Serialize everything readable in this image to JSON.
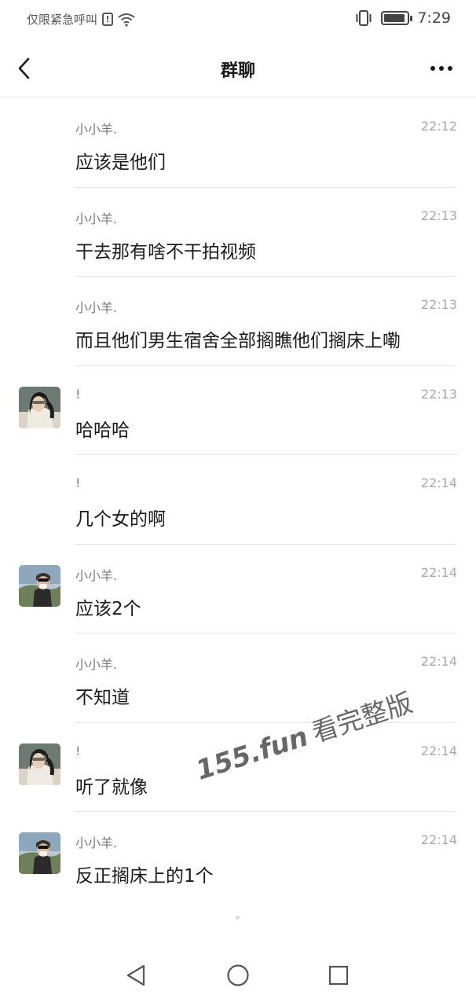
{
  "status_bar": {
    "carrier": "仅限紧急呼叫",
    "alert_glyph": "!",
    "time": "7:29",
    "battery_level": 0.9
  },
  "header": {
    "title": "群聊",
    "back_icon": "chevron-left-icon",
    "more_icon": "more-dots-icon"
  },
  "messages": [
    {
      "name": "小小羊.",
      "time": "22:12",
      "text": "应该是他们",
      "avatar": null
    },
    {
      "name": "小小羊.",
      "time": "22:13",
      "text": "干去那有啥不干拍视频",
      "avatar": null
    },
    {
      "name": "小小羊.",
      "time": "22:13",
      "text": "而且他们男生宿舍全部搁瞧他们搁床上嘞",
      "avatar": null
    },
    {
      "name": "!",
      "time": "22:13",
      "text": "哈哈哈",
      "avatar": "avatar-girl"
    },
    {
      "name": "!",
      "time": "22:14",
      "text": "几个女的啊",
      "avatar": null
    },
    {
      "name": "小小羊.",
      "time": "22:14",
      "text": "应该2个",
      "avatar": "avatar-sheep"
    },
    {
      "name": "小小羊.",
      "time": "22:14",
      "text": "不知道",
      "avatar": null
    },
    {
      "name": "!",
      "time": "22:14",
      "text": "听了就像",
      "avatar": "avatar-girl"
    },
    {
      "name": "小小羊.",
      "time": "22:14",
      "text": "反正搁床上的1个",
      "avatar": "avatar-sheep"
    }
  ],
  "watermark": {
    "site": "155.fun",
    "caption": "看完整版"
  },
  "nav_bar": {
    "back": "triangle-back-icon",
    "home": "circle-home-icon",
    "recents": "square-recents-icon"
  },
  "colors": {
    "text_primary": "#1a1a1a",
    "name": "#7a7a7a",
    "time": "#a8a8a8",
    "divider": "#e6e6e6"
  }
}
